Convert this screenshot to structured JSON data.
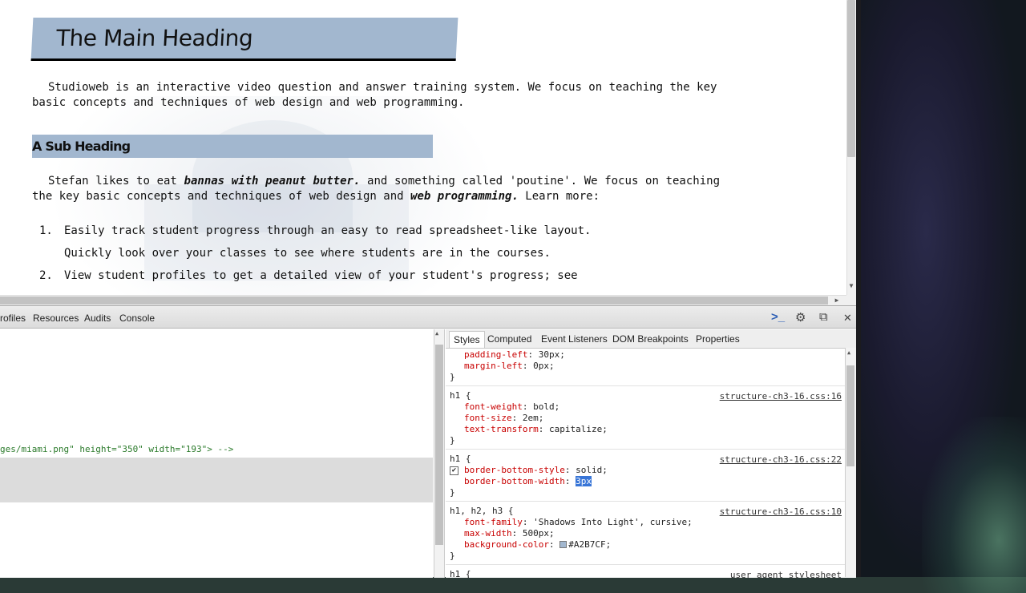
{
  "page": {
    "h1": "The Main Heading",
    "p1": "Studioweb is an interactive video question and answer training system. We focus on teaching the key basic concepts and techniques of web design and web programming.",
    "h2": "A Sub Heading",
    "p2_a": "Stefan likes to eat ",
    "p2_bold1": "bannas with peanut butter.",
    "p2_b": " and something called 'poutine'. We focus on teaching the key basic concepts and techniques of web design and ",
    "p2_bold2": "web programming.",
    "p2_c": " Learn more:",
    "list": [
      {
        "num": "1.",
        "text": "Easily track student progress through an easy to read spreadsheet-like layout. Quickly look over your classes to see where students are in the courses."
      },
      {
        "num": "2.",
        "text": "View student profiles to get a detailed view of your student's progress; see"
      }
    ]
  },
  "devtools": {
    "tabs": [
      "rofiles",
      "Resources",
      "Audits",
      "Console"
    ],
    "elements_line": "ges/miami.png\" height=\"350\" width=\"193\"> -->",
    "style_tabs": [
      "Styles",
      "Computed",
      "Event Listeners",
      "DOM Breakpoints",
      "Properties"
    ],
    "rules": {
      "r0": {
        "decls": [
          {
            "name": "padding-left",
            "value": "30px;"
          },
          {
            "name": "margin-left",
            "value": "0px;"
          }
        ],
        "close": "}"
      },
      "r1": {
        "selector": "h1 {",
        "source": "structure-ch3-16.css:16",
        "decls": [
          {
            "name": "font-weight",
            "value": "bold;"
          },
          {
            "name": "font-size",
            "value": "2em;"
          },
          {
            "name": "text-transform",
            "value": "capitalize;"
          }
        ],
        "close": "}"
      },
      "r2": {
        "selector": "h1 {",
        "source": "structure-ch3-16.css:22",
        "decls": [
          {
            "name": "border-bottom-style",
            "value": "solid;"
          },
          {
            "name": "border-bottom-width",
            "value": "3px"
          }
        ],
        "close": "}"
      },
      "r3": {
        "selector": "h1, h2, h3 {",
        "source": "structure-ch3-16.css:10",
        "decls": [
          {
            "name": "font-family",
            "value": "'Shadows Into Light', cursive;"
          },
          {
            "name": "max-width",
            "value": "500px;"
          },
          {
            "name": "background-color",
            "value": "#A2B7CF;"
          }
        ],
        "close": "}"
      },
      "r4": {
        "selector": "h1 {",
        "source": "user agent stylesheet"
      }
    }
  },
  "colors": {
    "heading_bg": "#A2B7CF",
    "prop_name": "#c80000",
    "selection": "#3875d7"
  },
  "icons": {
    "console": "console-prompt-icon",
    "settings": "gear-icon",
    "dock": "dock-window-icon",
    "close": "close-icon"
  }
}
